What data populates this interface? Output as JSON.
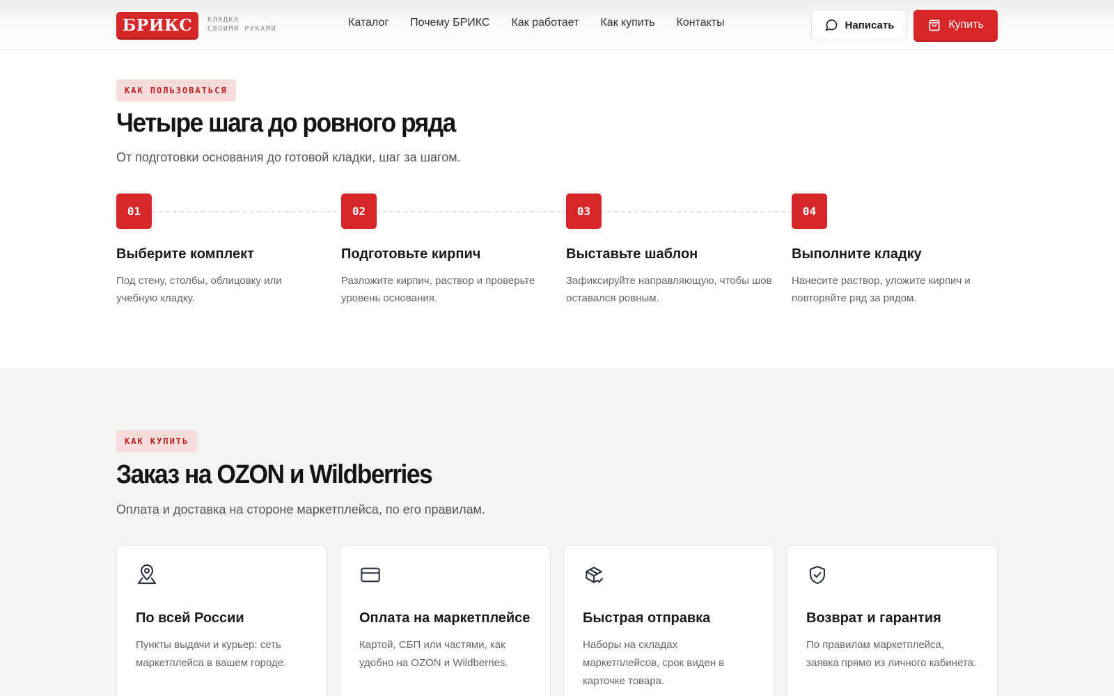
{
  "brand": {
    "name": "БРИКС",
    "tagline_line1": "КЛАДКА",
    "tagline_line2": "СВОИМИ РУКАМИ",
    "accent": "#d72628"
  },
  "nav": {
    "items": [
      "Каталог",
      "Почему БРИКС",
      "Как работает",
      "Как купить",
      "Контакты"
    ]
  },
  "header": {
    "write_label": "Написать",
    "buy_label": "Купить"
  },
  "how_to_use": {
    "badge": "КАК ПОЛЬЗОВАТЬСЯ",
    "title": "Четыре шага до ровного ряда",
    "lead": "От подготовки основания до готовой кладки, шаг за шагом.",
    "steps": [
      {
        "num": "01",
        "title": "Выберите комплект",
        "text": "Под стену, столбы, облицовку или учебную кладку."
      },
      {
        "num": "02",
        "title": "Подготовьте кирпич",
        "text": "Разложите кирпич, раствор и проверьте уровень основания."
      },
      {
        "num": "03",
        "title": "Выставьте шаблон",
        "text": "Зафиксируйте направляющую, чтобы шов оставался ровным."
      },
      {
        "num": "04",
        "title": "Выполните кладку",
        "text": "Нанесите раствор, уложите кирпич и повторяйте ряд за рядом."
      }
    ]
  },
  "how_to_buy": {
    "badge": "КАК КУПИТЬ",
    "title": "Заказ на OZON и Wildberries",
    "lead": "Оплата и доставка на стороне маркетплейса, по его правилам.",
    "cards": [
      {
        "icon": "map-pin-icon",
        "title": "По всей России",
        "text": "Пункты выдачи и курьер: сеть маркетплейса в вашем городе."
      },
      {
        "icon": "credit-card-icon",
        "title": "Оплата на маркетплейсе",
        "text": "Картой, СБП или частями, как удобно на OZON и Wildberries."
      },
      {
        "icon": "package-check-icon",
        "title": "Быстрая отправка",
        "text": "Наборы на складах маркетплейсов, срок виден в карточке товара."
      },
      {
        "icon": "shield-check-icon",
        "title": "Возврат и гарантия",
        "text": "По правилам маркетплейса, заявка прямо из личного кабинета."
      }
    ]
  }
}
